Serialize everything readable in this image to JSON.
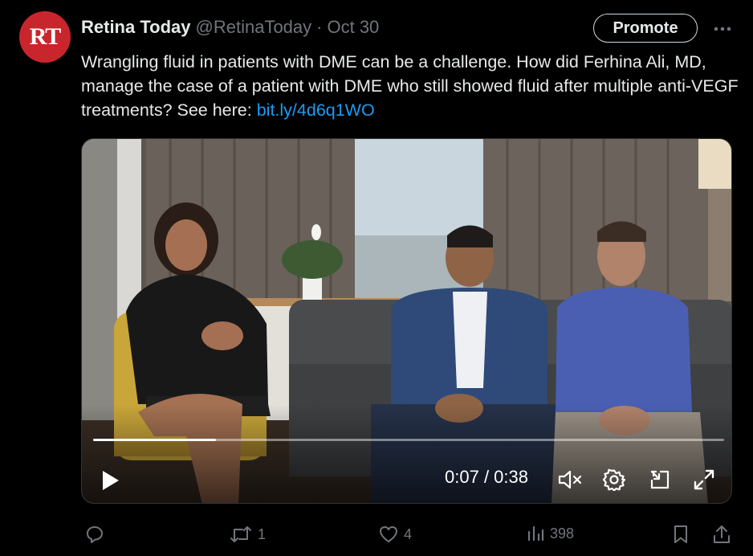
{
  "author": {
    "avatar_text": "RT",
    "display_name": "Retina Today",
    "handle": "@RetinaToday",
    "separator": "·",
    "date": "Oct 30"
  },
  "promote_label": "Promote",
  "more_icon": "more-horizontal-icon",
  "tweet": {
    "text": "Wrangling fluid in patients with DME can be a challenge. How did Ferhina Ali, MD, manage the case of a patient with DME who still showed fluid after multiple anti-VEGF treatments? See here: ",
    "link": "bit.ly/4d6q1WO"
  },
  "video": {
    "current_time": "0:07",
    "separator": " / ",
    "duration": "0:38",
    "progress_fraction": 0.195,
    "icons": [
      "play-icon",
      "mute-icon",
      "settings-icon",
      "minimize-icon",
      "fullscreen-icon"
    ]
  },
  "actions": {
    "reply_count": "",
    "retweet_count": "1",
    "like_count": "4",
    "view_count": "398"
  },
  "colors": {
    "accent": "#1d9bf0",
    "avatar_bg": "#c8262c",
    "muted": "#71767b",
    "text": "#e7e9ea"
  }
}
